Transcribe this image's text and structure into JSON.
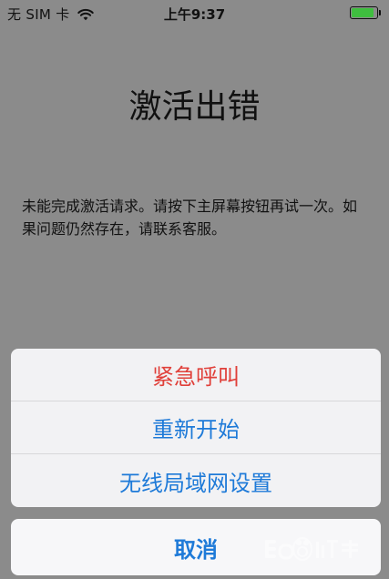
{
  "status_bar": {
    "carrier": "无 SIM 卡",
    "time": "上午9:37",
    "battery_level": 0.9,
    "battery_color": "#3fbe3f"
  },
  "screen": {
    "title": "激活出错",
    "message": "未能完成激活请求。请按下主屏幕按钮再试一次。如果问题仍然存在，请联系客服。"
  },
  "action_sheet": {
    "items": [
      {
        "label": "紧急呼叫",
        "style": "destructive"
      },
      {
        "label": "重新开始",
        "style": "default"
      },
      {
        "label": "无线局域网设置",
        "style": "default"
      }
    ],
    "cancel_label": "取消"
  },
  "colors": {
    "accent": "#1e7ad8",
    "destructive": "#e0403a",
    "backdrop": "#8b8b8b"
  }
}
